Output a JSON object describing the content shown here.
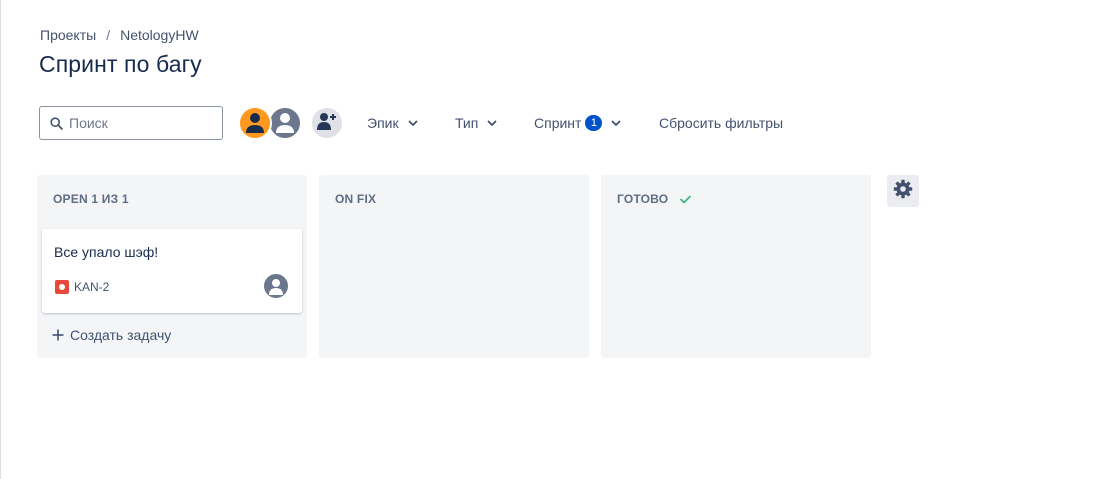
{
  "breadcrumb": {
    "projects": "Проекты",
    "separator": "/",
    "project": "NetologyHW"
  },
  "page_title": "Спринт по багу",
  "search": {
    "placeholder": "Поиск",
    "value": ""
  },
  "filters": {
    "epic_label": "Эпик",
    "type_label": "Тип",
    "sprint_label": "Спринт",
    "sprint_count": "1",
    "reset_label": "Сбросить фильтры"
  },
  "columns": [
    {
      "title": "OPEN 1 ИЗ 1",
      "cards": [
        {
          "summary": "Все упало шэф!",
          "key": "KAN-2",
          "issue_type_icon": "bug-icon",
          "assignee_icon": "user-avatar-icon"
        }
      ],
      "create_label": "Создать задачу"
    },
    {
      "title": "ON FIX",
      "cards": []
    },
    {
      "title": "ГОТОВО",
      "done_icon": "check-icon",
      "cards": []
    }
  ],
  "colors": {
    "accent": "#0052cc",
    "avatar_orange": "#ff991f",
    "avatar_grey": "#6b778c",
    "bug_red": "#e5493a",
    "done_green": "#36b37e",
    "column_bg": "#f4f5f7"
  },
  "icons": {
    "search": "search-icon",
    "add_people": "add-people-icon",
    "chevron": "chevron-down-icon",
    "settings": "gear-icon",
    "plus": "plus-icon"
  }
}
